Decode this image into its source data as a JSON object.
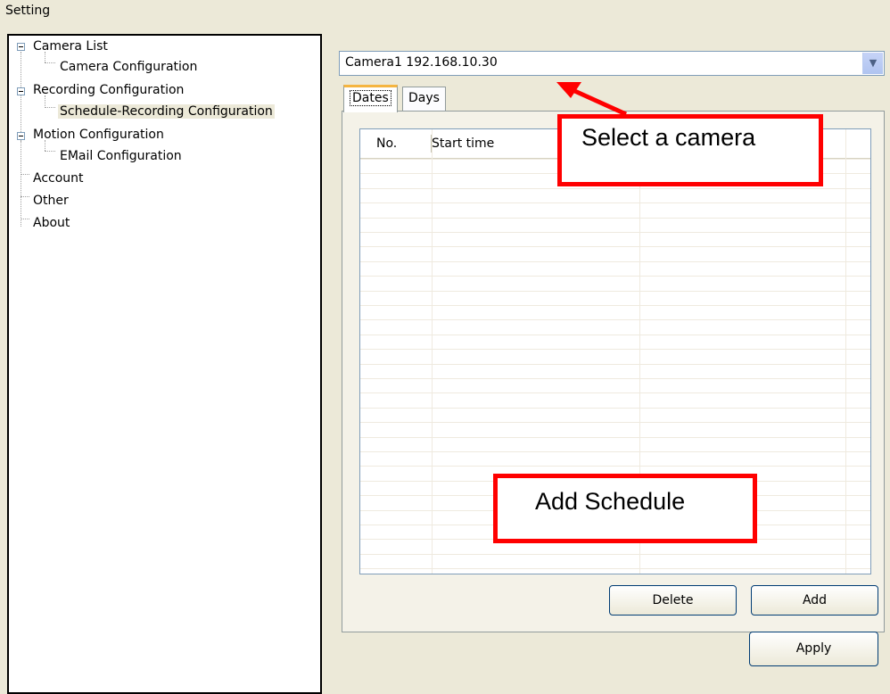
{
  "window": {
    "title": "Setting"
  },
  "tree": {
    "items": [
      {
        "label": "Camera List",
        "expanded": true
      },
      {
        "label": "Camera Configuration"
      },
      {
        "label": "Recording Configuration",
        "expanded": true
      },
      {
        "label": "Schedule-Recording Configuration",
        "selected": true
      },
      {
        "label": "Motion Configuration",
        "expanded": true
      },
      {
        "label": "EMail Configuration"
      },
      {
        "label": "Account"
      },
      {
        "label": "Other"
      },
      {
        "label": "About"
      }
    ]
  },
  "camera_select": {
    "value": "Camera1 192.168.10.30",
    "dropdown_icon": "chevron-down-icon"
  },
  "tabs": [
    {
      "label": "Dates",
      "active": true
    },
    {
      "label": "Days",
      "active": false
    }
  ],
  "grid": {
    "columns": [
      "No.",
      "Start time",
      ""
    ],
    "rows": []
  },
  "buttons": {
    "delete": "Delete",
    "add": "Add",
    "apply": "Apply"
  },
  "annotations": {
    "select_camera": "Select a camera",
    "add_schedule": "Add Schedule",
    "color": "#ff0000"
  }
}
